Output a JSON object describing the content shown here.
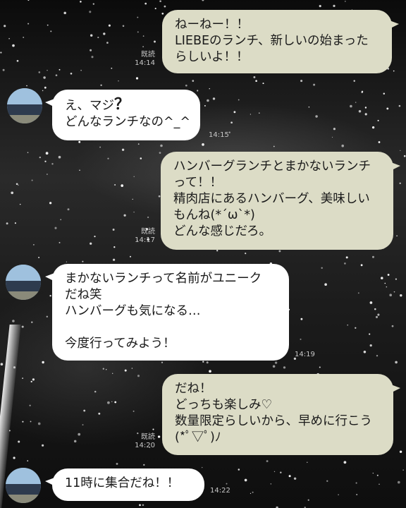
{
  "messages": [
    {
      "id": "m1",
      "side": "sent",
      "lines": [
        "ねーねー！！",
        "LIEBEのランチ、新しいの始まった",
        "らしいよ！！"
      ],
      "read": "既読",
      "time": "14:14"
    },
    {
      "id": "m2",
      "side": "recv",
      "lines": [
        "え、マジ",
        "どんなランチなの^_^"
      ],
      "time": "14:15"
    },
    {
      "id": "m3",
      "side": "sent",
      "lines": [
        "ハンバーグランチとまかないランチ",
        "って！！",
        "精肉店にあるハンバーグ、美味しい",
        "もんね(*´ω`*)",
        "どんな感じだろ。"
      ],
      "read": "既読",
      "time": "14:17"
    },
    {
      "id": "m4",
      "side": "recv",
      "lines": [
        "まかないランチって名前がユニーク",
        "だね笑",
        "ハンバーグも気になる…",
        "",
        "今度行ってみよう！"
      ],
      "time": "14:19"
    },
    {
      "id": "m5",
      "side": "sent",
      "lines": [
        "だね！",
        "どっちも楽しみ♡",
        "数量限定らしいから、早めに行こう",
        "(*ﾟ▽ﾟ)ﾉ"
      ],
      "read": "既読",
      "time": "14:20"
    },
    {
      "id": "m6",
      "side": "recv",
      "lines": [
        "11時に集合だね！！"
      ],
      "time": "14:22"
    }
  ],
  "icons": {
    "question": "？"
  },
  "colors": {
    "sent_bubble": "#dcdcc6",
    "recv_bubble": "#ffffff",
    "meta_text": "#c8c8c8"
  }
}
